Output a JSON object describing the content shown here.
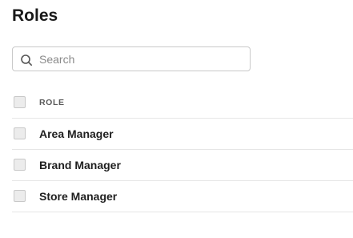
{
  "page": {
    "title": "Roles"
  },
  "search": {
    "placeholder": "Search",
    "value": "",
    "icon": "search-icon"
  },
  "table": {
    "columns": [
      "ROLE"
    ],
    "rows": [
      {
        "role": "Area Manager"
      },
      {
        "role": "Brand Manager"
      },
      {
        "role": "Store Manager"
      }
    ]
  }
}
